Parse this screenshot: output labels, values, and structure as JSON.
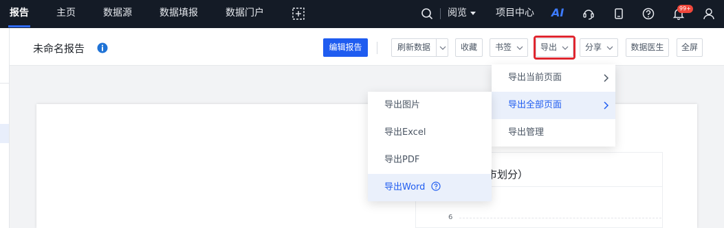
{
  "topnav": {
    "tabs": [
      "报告",
      "主页",
      "数据源",
      "数据填报",
      "数据门户"
    ],
    "browse_label": "阅览",
    "project_center": "项目中心",
    "ai_label": "AI",
    "notification_count": "99+"
  },
  "toolbar": {
    "report_title": "未命名报告",
    "edit_report": "编辑报告",
    "refresh_data": "刷新数据",
    "favorite": "收藏",
    "bookmark": "书签",
    "export": "导出",
    "share": "分享",
    "data_doctor": "数据医生",
    "fullscreen": "全屏"
  },
  "export_menu": {
    "items": [
      "导出当前页面",
      "导出全部页面",
      "导出管理"
    ],
    "selected": "导出全部页面"
  },
  "export_submenu": {
    "items": [
      "导出图片",
      "导出Excel",
      "导出PDF",
      "导出Word"
    ],
    "highlighted": "导出Word"
  },
  "chart": {
    "title_fragment": "市划分）",
    "y_tick": "6"
  },
  "colors": {
    "nav_bg": "#141b26",
    "primary": "#1f5cf0",
    "highlight_border": "#e0262f",
    "badge": "#f0473b"
  }
}
